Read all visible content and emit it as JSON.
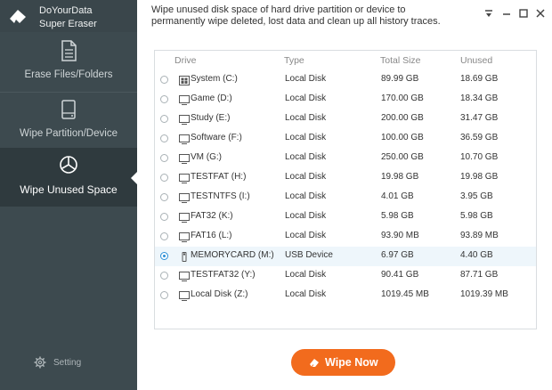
{
  "app": {
    "name_line1": "DoYourData",
    "name_line2": "Super Eraser",
    "description": "Wipe unused disk space of hard drive partition or device to permanently wipe deleted, lost data and clean up all history traces."
  },
  "sidebar": {
    "items": [
      {
        "label": "Erase Files/Folders",
        "icon": "document-icon",
        "active": false
      },
      {
        "label": "Wipe Partition/Device",
        "icon": "hard-drive-icon",
        "active": false
      },
      {
        "label": "Wipe Unused Space",
        "icon": "pie-chart-icon",
        "active": true
      }
    ],
    "setting_label": "Setting"
  },
  "window_controls": [
    "dropdown-menu-icon",
    "minimize-icon",
    "maximize-icon",
    "close-icon"
  ],
  "table": {
    "headers": {
      "drive": "Drive",
      "type": "Type",
      "total": "Total Size",
      "unused": "Unused"
    },
    "rows": [
      {
        "drive": "System (C:)",
        "icon": "system-drive-icon",
        "type": "Local Disk",
        "total": "89.99 GB",
        "unused": "18.69 GB",
        "selected": false
      },
      {
        "drive": "Game (D:)",
        "icon": "drive-icon",
        "type": "Local Disk",
        "total": "170.00 GB",
        "unused": "18.34 GB",
        "selected": false
      },
      {
        "drive": "Study (E:)",
        "icon": "drive-icon",
        "type": "Local Disk",
        "total": "200.00 GB",
        "unused": "31.47 GB",
        "selected": false
      },
      {
        "drive": "Software (F:)",
        "icon": "drive-icon",
        "type": "Local Disk",
        "total": "100.00 GB",
        "unused": "36.59 GB",
        "selected": false
      },
      {
        "drive": "VM (G:)",
        "icon": "drive-icon",
        "type": "Local Disk",
        "total": "250.00 GB",
        "unused": "10.70 GB",
        "selected": false
      },
      {
        "drive": "TESTFAT (H:)",
        "icon": "drive-icon",
        "type": "Local Disk",
        "total": "19.98 GB",
        "unused": "19.98 GB",
        "selected": false
      },
      {
        "drive": "TESTNTFS (I:)",
        "icon": "drive-icon",
        "type": "Local Disk",
        "total": "4.01 GB",
        "unused": "3.95 GB",
        "selected": false
      },
      {
        "drive": "FAT32 (K:)",
        "icon": "drive-icon",
        "type": "Local Disk",
        "total": "5.98 GB",
        "unused": "5.98 GB",
        "selected": false
      },
      {
        "drive": "FAT16 (L:)",
        "icon": "drive-icon",
        "type": "Local Disk",
        "total": "93.90 MB",
        "unused": "93.89 MB",
        "selected": false
      },
      {
        "drive": "MEMORYCARD (M:)",
        "icon": "usb-icon",
        "type": "USB Device",
        "total": "6.97 GB",
        "unused": "4.40 GB",
        "selected": true
      },
      {
        "drive": "TESTFAT32 (Y:)",
        "icon": "drive-icon",
        "type": "Local Disk",
        "total": "90.41 GB",
        "unused": "87.71 GB",
        "selected": false
      },
      {
        "drive": "Local Disk (Z:)",
        "icon": "drive-icon",
        "type": "Local Disk",
        "total": "1019.45 MB",
        "unused": "1019.39 MB",
        "selected": false
      }
    ]
  },
  "actions": {
    "wipe_now_label": "Wipe Now"
  },
  "colors": {
    "sidebar": "#3d4a4f",
    "accent": "#f26b1d",
    "selection": "#2b8fd6"
  }
}
